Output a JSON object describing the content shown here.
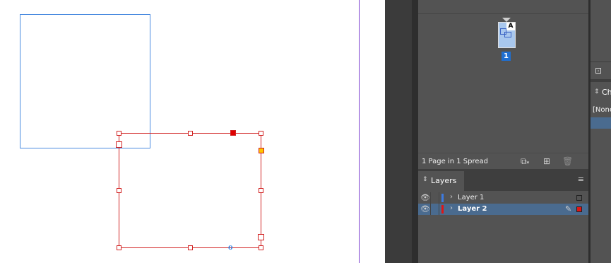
{
  "pages_panel": {
    "master_label": "A",
    "page_number": "1",
    "summary": "1 Page in 1 Spread",
    "icons": [
      "page-size-icon",
      "new-page-icon",
      "trash-icon"
    ]
  },
  "layers_panel": {
    "tab_label": "Layers",
    "layers": [
      {
        "name": "Layer 1",
        "color": "#3d7be0",
        "visible": true,
        "selected": false
      },
      {
        "name": "Layer 2",
        "color": "#e01515",
        "visible": true,
        "selected": true
      }
    ]
  },
  "right_panel": {
    "tab_label": "Ch",
    "item_label": "[None"
  },
  "colors": {
    "frame_blue": "#4a8be0",
    "frame_red": "#d12222",
    "page_edge": "#7a3fd0",
    "selection_row": "#4a6b8f"
  }
}
